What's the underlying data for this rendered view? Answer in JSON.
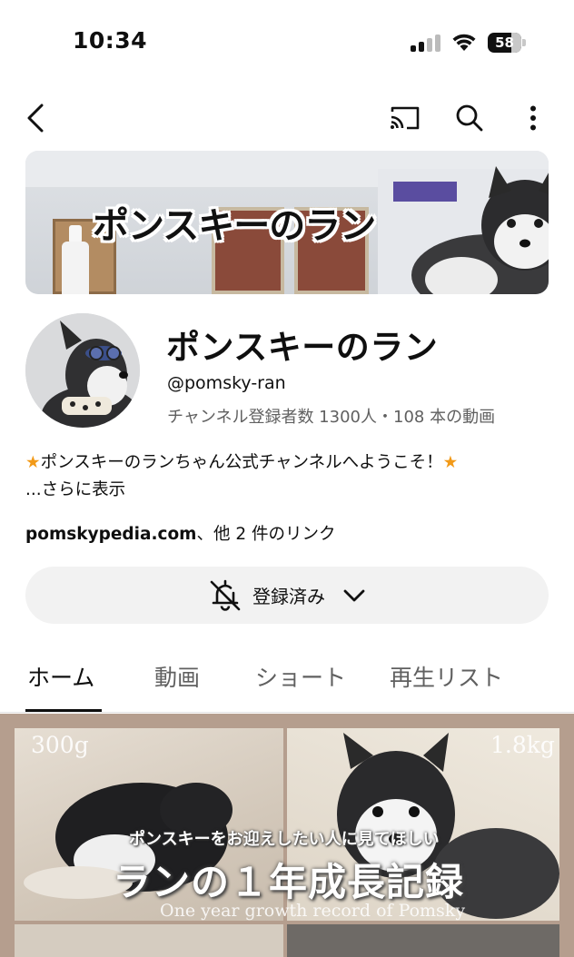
{
  "status_bar": {
    "time": "10:34",
    "battery": "58"
  },
  "app_bar": {
    "icons": [
      "back-icon",
      "cast-icon",
      "search-icon",
      "more-vert-icon"
    ]
  },
  "banner": {
    "title": "ポンスキーのラン"
  },
  "channel": {
    "name": "ポンスキーのラン",
    "handle": "@pomsky-ran",
    "stats": "チャンネル登録者数 1300人・108 本の動画",
    "description_star": "★",
    "description": "ポンスキーのランちゃん公式チャンネルへようこそ！",
    "more": "...さらに表示",
    "link_domain": "pomskypedia.com",
    "link_suffix": "、他 2 件のリンク"
  },
  "subscribe": {
    "label": "登録済み"
  },
  "tabs": [
    {
      "label": "ホーム",
      "active": true
    },
    {
      "label": "動画",
      "active": false
    },
    {
      "label": "ショート",
      "active": false
    },
    {
      "label": "再生リスト",
      "active": false
    }
  ],
  "featured": {
    "weight_left": "300g",
    "weight_right": "1.8kg",
    "subtitle": "ポンスキーをお迎えしたい人に見てほしい",
    "title": "ランの１年成長記録",
    "english": "One year growth record of Pomsky"
  },
  "colors": {
    "star": "#f29a18",
    "secondary_text": "#606060",
    "subscribe_bg": "#f2f2f2"
  }
}
